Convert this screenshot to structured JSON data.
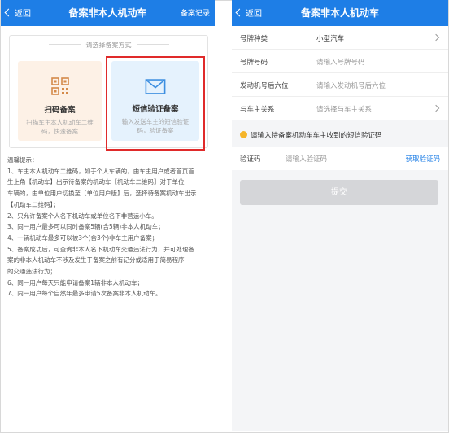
{
  "left": {
    "header": {
      "back_label": "返回",
      "title": "备案非本人机动车",
      "right_label": "备案记录"
    },
    "method_title": "请选择备案方式",
    "cards": [
      {
        "icon": "qr-code-icon",
        "label": "扫码备案",
        "desc": "扫描车主本人机动车二维码，快速备案"
      },
      {
        "icon": "envelope-icon",
        "label": "短信验证备案",
        "desc": "输入发送车主的短信验证码，验证备案"
      }
    ],
    "tips_title": "温馨提示：",
    "tips": [
      "1、车主本人机动车二维码，如于个人车辆的，由车主用户或者首页首",
      "生上角【机动车】出示待备案的机动车【机动车二维码】对于单位",
      "车辆的，由单位用户切换至【单位用户版】后，选择待备案机动车出示",
      "【机动车二维码】；",
      "2、只允许备案个人名下机动车或单位名下非营运小车。",
      "3、同一用户最多可以同时备案5辆(含5辆)非本人机动车；",
      "4、一辆机动车最多可以被3个(含3个)非车主用户备案；",
      "5、备案成功后，可查询非本人名下机动车交通违法行为，并可处理备",
      "案的非本人机动车不涉及发生于备案之前有记分或适用于简易程序",
      "的交通违法行为；",
      "6、同一用户每天只能申请备案1辆非本人机动车；",
      "7、同一用户每个自然年最多申请5次备案非本人机动车。"
    ]
  },
  "right": {
    "header": {
      "back_label": "返回",
      "title": "备案非本人机动车"
    },
    "fields": [
      {
        "label": "号牌种类",
        "value": "小型汽车",
        "placeholder": false,
        "has_arrow": true
      },
      {
        "label": "号牌号码",
        "value": "请输入号牌号码",
        "placeholder": true,
        "has_arrow": false
      },
      {
        "label": "发动机号后六位",
        "value": "请输入发动机号后六位",
        "placeholder": true,
        "has_arrow": false
      },
      {
        "label": "与车主关系",
        "value": "请选择与车主关系",
        "placeholder": true,
        "has_arrow": true
      }
    ],
    "notice": "请输入待备案机动车车主收到的短信验证码",
    "verify": {
      "label": "验证码",
      "placeholder": "请输入验证码",
      "get_code": "获取验证码"
    },
    "submit_label": "提交"
  },
  "colors": {
    "primary": "#1e7ee6",
    "highlight": "#e02a2a",
    "qr_card_bg": "#fdf1e6",
    "sms_card_bg": "#e5f2fd",
    "notice_dot": "#f5b52a"
  }
}
